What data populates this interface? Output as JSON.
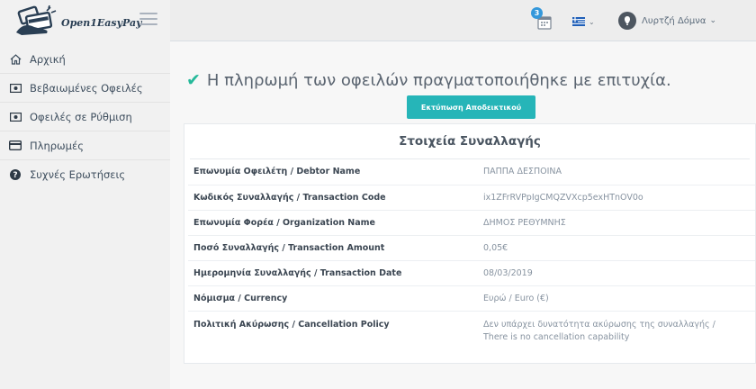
{
  "brand": {
    "name": "Open1EasyPay"
  },
  "sidebar": {
    "items": [
      {
        "label": "Αρχική",
        "icon": "home-icon"
      },
      {
        "label": "Βεβαιωμένες Οφειλές",
        "icon": "money-icon"
      },
      {
        "label": "Οφειλές σε Ρύθμιση",
        "icon": "money-icon"
      },
      {
        "label": "Πληρωμές",
        "icon": "credit-card-icon"
      },
      {
        "label": "Συχνές Ερωτήσεις",
        "icon": "question-circle-icon"
      }
    ]
  },
  "topbar": {
    "notification_count": "3",
    "user_name": "Λυρτζή Δόμνα"
  },
  "main": {
    "success_message": "Η πληρωμή των οφειλών πραγματοποιήθηκε με επιτυχία.",
    "print_button": "Εκτύπωση Αποδεικτικού",
    "panel_title": "Στοιχεία Συναλλαγής",
    "rows": [
      {
        "label": "Επωνυμία Οφειλέτη / Debtor Name",
        "value": "ΠΑΠΠΑ ΔΕΣΠΟΙΝΑ"
      },
      {
        "label": "Κωδικός Συναλλαγής / Transaction Code",
        "value": "ix1ZFrRVPpIgCMQZVXcp5exHTnOV0o"
      },
      {
        "label": "Επωνυμία Φορέα / Organization Name",
        "value": "ΔΗΜΟΣ ΡΕΘΥΜΝΗΣ"
      },
      {
        "label": "Ποσό Συναλλαγής / Transaction Amount",
        "value": "0,05€"
      },
      {
        "label": "Ημερομηνία Συναλλαγής / Transaction Date",
        "value": "08/03/2019"
      },
      {
        "label": "Νόμισμα / Currency",
        "value": "Ευρώ / Euro (€)"
      },
      {
        "label": "Πολιτική Ακύρωσης / Cancellation Policy",
        "value": "Δεν υπάρχει δυνατότητα ακύρωσης της συναλλαγής /",
        "value2": "There is no cancellation capability"
      }
    ]
  },
  "colors": {
    "accent": "#26b5b8",
    "success": "#26b99a",
    "badge": "#3498db"
  }
}
